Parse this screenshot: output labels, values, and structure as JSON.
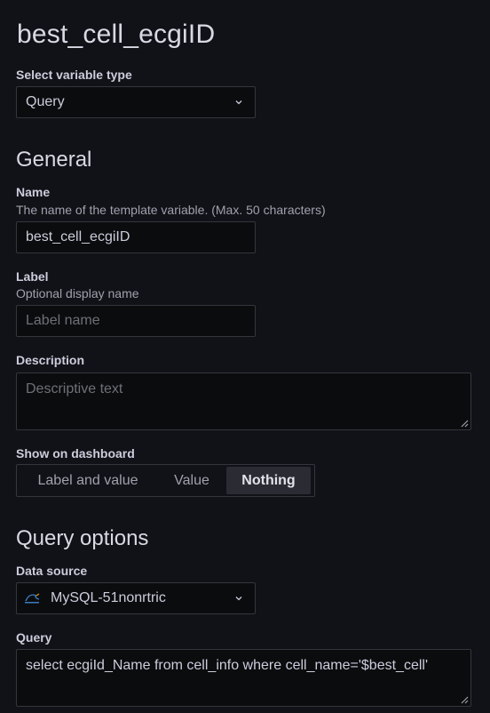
{
  "page": {
    "title": "best_cell_ecgiID"
  },
  "variable_type": {
    "label": "Select variable type",
    "value": "Query"
  },
  "general": {
    "title": "General",
    "name": {
      "label": "Name",
      "description": "The name of the template variable. (Max. 50 characters)",
      "value": "best_cell_ecgiID"
    },
    "label": {
      "label": "Label",
      "description": "Optional display name",
      "placeholder": "Label name",
      "value": ""
    },
    "description": {
      "label": "Description",
      "placeholder": "Descriptive text",
      "value": ""
    },
    "show_on_dashboard": {
      "label": "Show on dashboard",
      "options": [
        "Label and value",
        "Value",
        "Nothing"
      ],
      "selected": "Nothing"
    }
  },
  "query_options": {
    "title": "Query options",
    "data_source": {
      "label": "Data source",
      "value": "MySQL-51nonrtric",
      "icon": "mysql-logo-icon"
    },
    "query": {
      "label": "Query",
      "value": "select ecgiId_Name from cell_info where cell_name='$best_cell'"
    }
  },
  "colors": {
    "background": "#111217",
    "input_background": "#0b0c0e",
    "border": "#34363d",
    "selected_option_bg": "#2b2c33"
  }
}
